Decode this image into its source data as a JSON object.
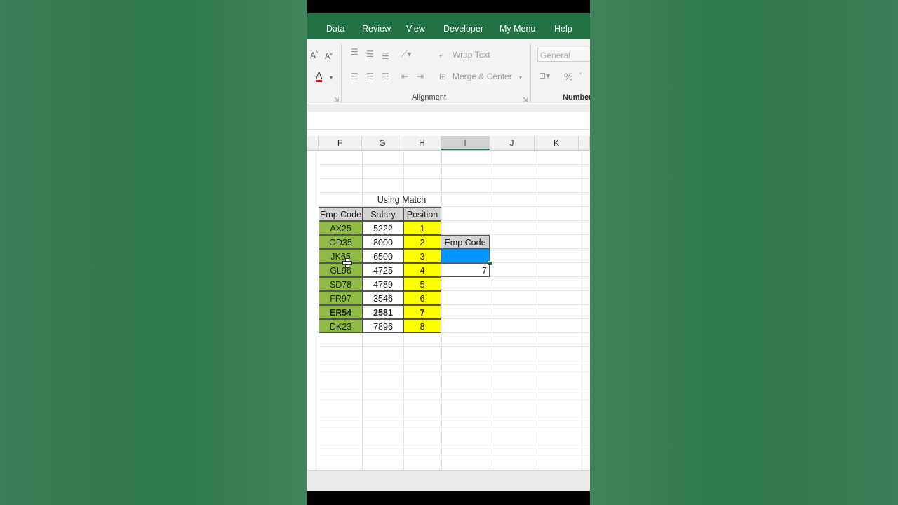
{
  "ribbon_tabs": [
    "Data",
    "Review",
    "View",
    "Developer",
    "My Menu",
    "Help"
  ],
  "ribbon": {
    "wrap_text": "Wrap Text",
    "merge_center": "Merge & Center",
    "number_format": "General",
    "alignment_label": "Alignment",
    "number_label": "Number",
    "percent": "%"
  },
  "columns": [
    "F",
    "G",
    "H",
    "I",
    "J",
    "K"
  ],
  "active_column": "I",
  "table": {
    "title": "Using Match",
    "headers": [
      "Emp Code",
      "Salary",
      "Position"
    ],
    "rows": [
      {
        "code": "AX25",
        "salary": "5222",
        "position": "1"
      },
      {
        "code": "OD35",
        "salary": "8000",
        "position": "2"
      },
      {
        "code": "JK65",
        "salary": "6500",
        "position": "3"
      },
      {
        "code": "GL96",
        "salary": "4725",
        "position": "4"
      },
      {
        "code": "SD78",
        "salary": "4789",
        "position": "5"
      },
      {
        "code": "FR97",
        "salary": "3546",
        "position": "6"
      },
      {
        "code": "ER54",
        "salary": "2581",
        "position": "7"
      },
      {
        "code": "DK23",
        "salary": "7896",
        "position": "8"
      }
    ]
  },
  "lookup": {
    "label": "Emp Code",
    "input_value": "",
    "result": "7"
  },
  "colors": {
    "excel_green": "#217346",
    "code_fill": "#8dbb45",
    "position_fill": "#ffff00",
    "header_fill": "#d3d3d3",
    "selected_cell": "#0096ff"
  }
}
